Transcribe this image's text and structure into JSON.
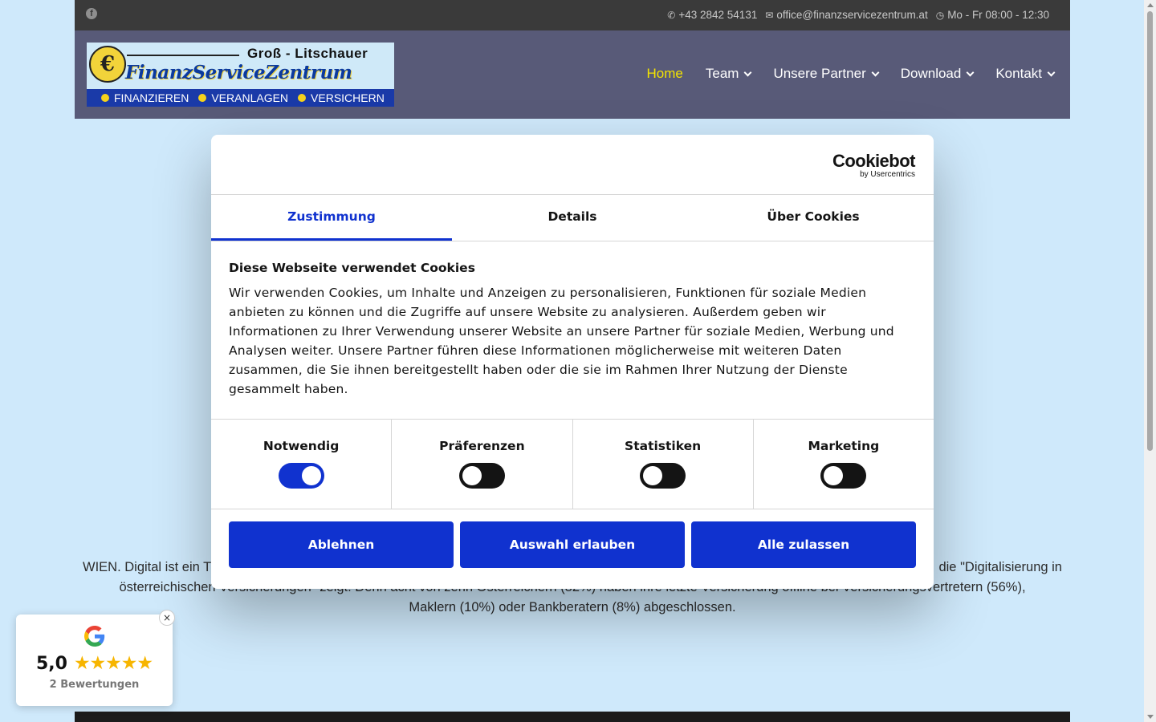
{
  "topbar": {
    "phone": "+43 2842 54131",
    "email": "office@finanzservicezentrum.at",
    "hours": "Mo - Fr 08:00 - 12:30"
  },
  "logo": {
    "top_text": "Groß - Litschauer",
    "main_text": "FinanzServiceZentrum",
    "tagline": [
      "FINANZIEREN",
      "VERANLAGEN",
      "VERSICHERN"
    ]
  },
  "nav": {
    "items": [
      {
        "label": "Home",
        "active": true
      },
      {
        "label": "Team",
        "dropdown": true
      },
      {
        "label": "Unsere Partner",
        "dropdown": true
      },
      {
        "label": "Download",
        "dropdown": true
      },
      {
        "label": "Kontakt",
        "dropdown": true
      }
    ]
  },
  "article": {
    "line1_left": "WIEN. Digital ist ein T",
    "line1_right": "die \"Digitalisierung in",
    "line2": "österreichischen Versicherungen\" zeigt. Denn acht von zehn Österreichern (82%) haben ihre letzte Versicherung offline bei Versicherungsvertretern (56%),",
    "line3": "Maklern (10%) oder Bankberatern (8%) abgeschlossen."
  },
  "cookie": {
    "brand": "Cookiebot",
    "brand_sub": "by Usercentrics",
    "tabs": [
      "Zustimmung",
      "Details",
      "Über Cookies"
    ],
    "heading": "Diese Webseite verwendet Cookies",
    "body": "Wir verwenden Cookies, um Inhalte und Anzeigen zu personalisieren, Funktionen für soziale Medien anbieten zu können und die Zugriffe auf unsere Website zu analysieren. Außerdem geben wir Informationen zu Ihrer Verwendung unserer Website an unsere Partner für soziale Medien, Werbung und Analysen weiter. Unsere Partner führen diese Informationen möglicherweise mit weiteren Daten zusammen, die Sie ihnen bereitgestellt haben oder die sie im Rahmen Ihrer Nutzung der Dienste gesammelt haben.",
    "toggles": [
      {
        "label": "Notwendig",
        "on": true
      },
      {
        "label": "Präferenzen",
        "on": false
      },
      {
        "label": "Statistiken",
        "on": false
      },
      {
        "label": "Marketing",
        "on": false
      }
    ],
    "buttons": [
      "Ablehnen",
      "Auswahl erlauben",
      "Alle zulassen"
    ],
    "accent": "#1032cf"
  },
  "google_widget": {
    "score": "5,0",
    "stars": "★★★★★",
    "reviews": "2 Bewertungen",
    "close": "×"
  }
}
